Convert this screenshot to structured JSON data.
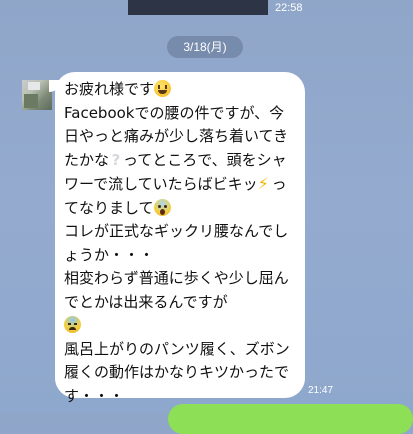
{
  "status_bar": {
    "time": "22:58"
  },
  "date_divider": {
    "label": "3/18(月)"
  },
  "incoming_message": {
    "lines": {
      "l1": "お疲れ様です",
      "l2": "Facebookでの腰の件ですが、今日やっと痛みが少し落ち着いてきたかな",
      "l3": "ってところで、頭をシャワーで流していたらばビキッ",
      "l4": "ってなりまして",
      "l5": "コレが正式なギックリ腰なんでしょうか・・・",
      "l6": "相変わらず普通に歩くや少し屈んでとかは出来るんですが",
      "l7": "風呂上がりのパンツ履く、ズボン履くの動作はかなりキツかったです・・・"
    },
    "emojis": [
      "grinning-face",
      "white-question-mark",
      "high-voltage",
      "face-screaming",
      "anxious-face-with-sweat"
    ],
    "time": "21:47"
  },
  "colors": {
    "background": "#94abcf",
    "incoming_bubble": "#ffffff",
    "outgoing_bubble": "#8de055",
    "date_pill": "#627494"
  }
}
